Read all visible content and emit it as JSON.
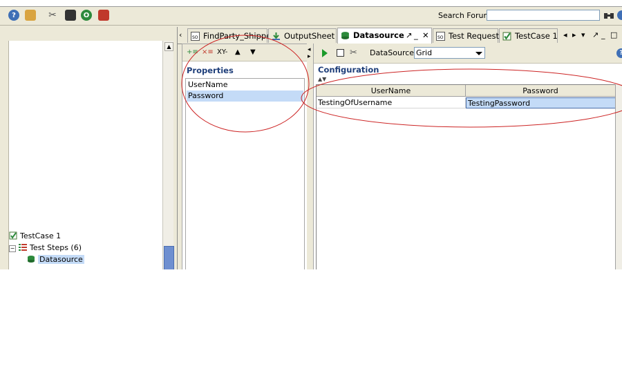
{
  "toolbar": {
    "search_label": "Search Forum",
    "search_value": ""
  },
  "tabs": [
    {
      "label": "FindParty_Shipper"
    },
    {
      "label": "OutputSheet"
    },
    {
      "label": "Datasource"
    },
    {
      "label": "Test Request"
    },
    {
      "label": "TestCase 1"
    }
  ],
  "navigator": {
    "items": [
      {
        "label": "TestCase 1"
      },
      {
        "label": "Test Steps (6)"
      },
      {
        "label": "Datasource"
      }
    ]
  },
  "properties": {
    "title": "Properties",
    "toolbar_xy": "XY-",
    "items": [
      {
        "label": "UserName"
      },
      {
        "label": "Password"
      }
    ]
  },
  "configuration": {
    "title": "Configuration",
    "datasource_label": "DataSource:",
    "datasource_value": "Grid",
    "columns": [
      "UserName",
      "Password"
    ],
    "rows": [
      [
        "TestingOfUsername",
        "TestingPassword"
      ]
    ]
  },
  "colors": {
    "selection": "#c4dbf7",
    "accent_title": "#1f3f7a",
    "annotation": "#cc2222"
  }
}
